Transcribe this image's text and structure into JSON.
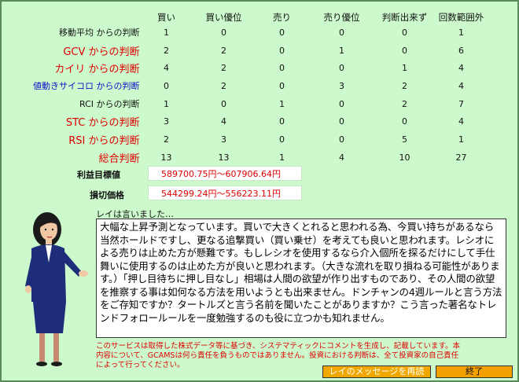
{
  "columns": [
    "買い",
    "買い優位",
    "売り",
    "売り優位",
    "判断出来ず",
    "回数範囲外"
  ],
  "rows": [
    {
      "label": "移動平均 からの判断",
      "style": "plain",
      "values": [
        "1",
        "0",
        "0",
        "0",
        "0",
        "1"
      ]
    },
    {
      "label": "GCV からの判断",
      "style": "red",
      "values": [
        "2",
        "2",
        "0",
        "1",
        "0",
        "6"
      ]
    },
    {
      "label": "カイリ からの判断",
      "style": "red",
      "values": [
        "4",
        "2",
        "0",
        "0",
        "1",
        "4"
      ]
    },
    {
      "label": "値動きサイコロ からの判断",
      "style": "blue",
      "values": [
        "0",
        "2",
        "0",
        "3",
        "2",
        "4"
      ]
    },
    {
      "label": "RCI からの判断",
      "style": "plain",
      "values": [
        "1",
        "0",
        "1",
        "0",
        "2",
        "7"
      ]
    },
    {
      "label": "STC からの判断",
      "style": "red",
      "values": [
        "3",
        "4",
        "0",
        "0",
        "0",
        "4"
      ]
    },
    {
      "label": "RSI からの判断",
      "style": "red",
      "values": [
        "2",
        "3",
        "0",
        "0",
        "5",
        "1"
      ]
    },
    {
      "label": "総合判断",
      "style": "tot",
      "values": [
        "13",
        "13",
        "1",
        "4",
        "10",
        "27"
      ]
    }
  ],
  "target": {
    "label": "利益目標値",
    "value": "589700.75円～607906.64円"
  },
  "stoploss": {
    "label": "損切価格",
    "value": "544299.24円～556223.11円"
  },
  "speaker": "レイは言いました…",
  "speech": "大幅な上昇予測となっています。買いで大きくとれると思われる為、今買い持ちがあるなら当然ホールドですし、更なる追撃買い（買い乗せ）を考えても良いと思われます。レシオによる売りは止めた方が懸難です。もしレシオを使用するなら介入個所を探るだけにして手仕舞いに使用するのは止めた方が良いと思われます。（大きな流れを取り損ねる可能性があります。）「押し目待ちに押し目なし」相場は人間の欲望が作り出すものであり、その人間の欲望を推察する事は如何なる方法を用いようとも出来ません。ドンチャンの4週ルールと言う方法をご存知ですか？タートルズと言う名前を聞いたことがありますか？こう言った著名なトレンドフォロールールを一度勉強するのも役に立つかも知れません。",
  "notice": "このサービスは取得した株式データ等に基づき、システマティックにコメントを生成し、記載しています。本内容について、GCAMSは何ら責任を負うものではありません。投資における判断は、全て投資家の自己責任によって行ってください。",
  "buttons": {
    "reread": "レイのメッセージを再読",
    "end": "終了"
  }
}
